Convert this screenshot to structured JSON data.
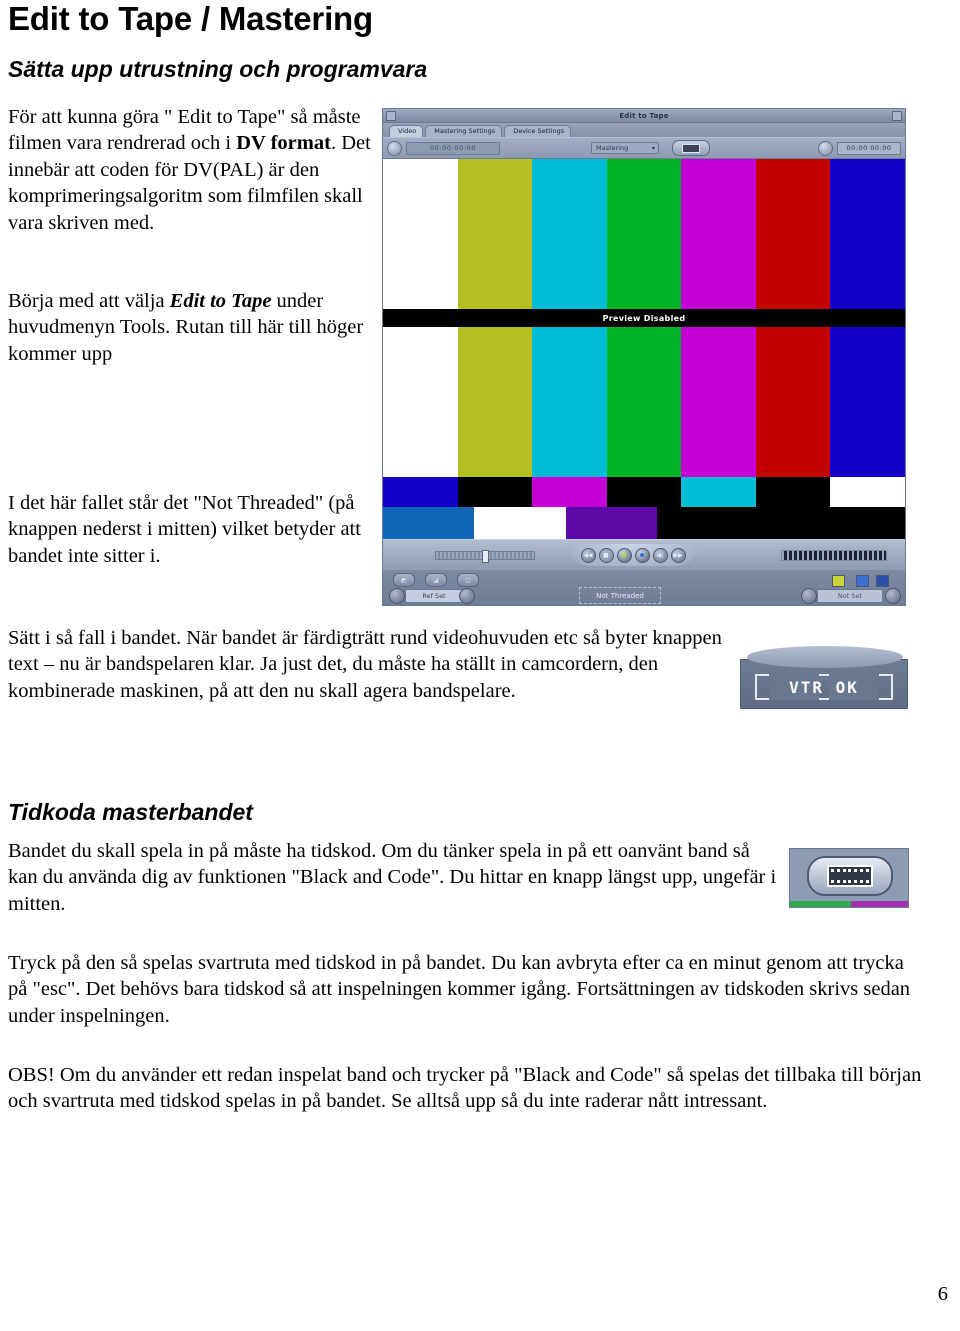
{
  "document": {
    "title": "Edit to Tape / Mastering",
    "page_number": "6",
    "sections": [
      {
        "heading": "Sätta upp utrustning och programvara",
        "paragraphs": [
          "För att kunna göra \" Edit to Tape\" så måste filmen vara rendrerad och i DV format. Det innebär att coden för DV(PAL) är den komprimeringsalgoritm som filmfilen skall vara skriven med.",
          "Börja med att välja Edit to Tape under huvudmenyn Tools. Rutan till här till höger kommer upp",
          "I det här fallet står det \"Not Threaded\" (på knappen nederst i mitten) vilket betyder att bandet inte sitter i.",
          "Sätt i så fall i bandet. När bandet är färdigträtt rund videohuvuden etc så byter knappen text – nu är bandspelaren klar. Ja just det, du måste ha ställt in camcordern, den kombinerade maskinen, på att den nu skall agera bandspelare."
        ]
      },
      {
        "heading": "Tidkoda masterbandet",
        "paragraphs": [
          "Bandet du skall spela in på måste ha tidskod. Om du tänker spela in på ett oanvänt band så kan du använda dig av funktionen \"Black and Code\". Du hittar en knapp längst upp, ungefär i mitten.",
          "Tryck på den så spelas svartruta med tidskod in på bandet. Du kan avbryta efter ca en minut genom att trycka på \"esc\". Det behövs bara tidskod så att inspelningen kommer igång. Fortsättningen av tidskoden skrivs sedan under inspelningen.",
          "OBS! Om du använder ett redan inspelat band och trycker på \"Black and Code\" så spelas det tillbaka till början och svartruta med tidskod spelas in på bandet. Se alltså upp så du inte raderar nått intressant."
        ]
      }
    ],
    "inline_bold": {
      "p1_bold": "DV format",
      "p2_bolditalic": "Edit to Tape"
    }
  },
  "edit_to_tape_window": {
    "title": "Edit to Tape",
    "tabs": [
      {
        "label": "Video",
        "active": true
      },
      {
        "label": "Mastering Settings",
        "active": false
      },
      {
        "label": "Device Settings",
        "active": false
      }
    ],
    "toolbar": {
      "timecode_left": "00:00:00:00",
      "mode_select_value": "Mastering",
      "mode_select_arrow": "▾",
      "timecode_right": "00:00 00:00",
      "black_and_code_button": "film-strip"
    },
    "video": {
      "preview_text": "Preview Disabled",
      "bars_top": [
        "#ffffff",
        "#b4bf22",
        "#00bcd4",
        "#00b428",
        "#c400d4",
        "#c40000",
        "#1400c8"
      ],
      "bars_mid": [
        "#ffffff",
        "#b4bf22",
        "#00bcd4",
        "#00b428",
        "#c400d4",
        "#c40000",
        "#1400c8"
      ],
      "bars_bottom": [
        "#1400c8",
        "#000000",
        "#c400d4",
        "#000000",
        "#00bcd4",
        "#000000",
        "#ffffff"
      ],
      "bars_pluge": [
        "#1066b4",
        "#ffffff",
        "#5c09a8",
        "#000000",
        "#000000",
        "#000000",
        "#000000"
      ]
    },
    "controls": {
      "transport_buttons": [
        "rewind",
        "stop",
        "record",
        "play",
        "step-back",
        "fast-forward"
      ],
      "scrub_slider": "scrub-slider",
      "audio_meter": "audio-meter"
    },
    "status_bar": {
      "ref_set_label": "Ref Set",
      "threaded_label": "Not Threaded",
      "not_set_label": "Not Set"
    }
  },
  "vtr_widget": {
    "label": "VTR OK"
  },
  "black_and_code_widget": {
    "icon": "film-strip-icon"
  },
  "colors": {
    "window_chrome": "#8f9cb5",
    "title_bar": "#9eabc2",
    "status_bar": "#7d8aa4",
    "accent_green": "#2fa84f",
    "accent_magenta": "#a42fb0"
  }
}
